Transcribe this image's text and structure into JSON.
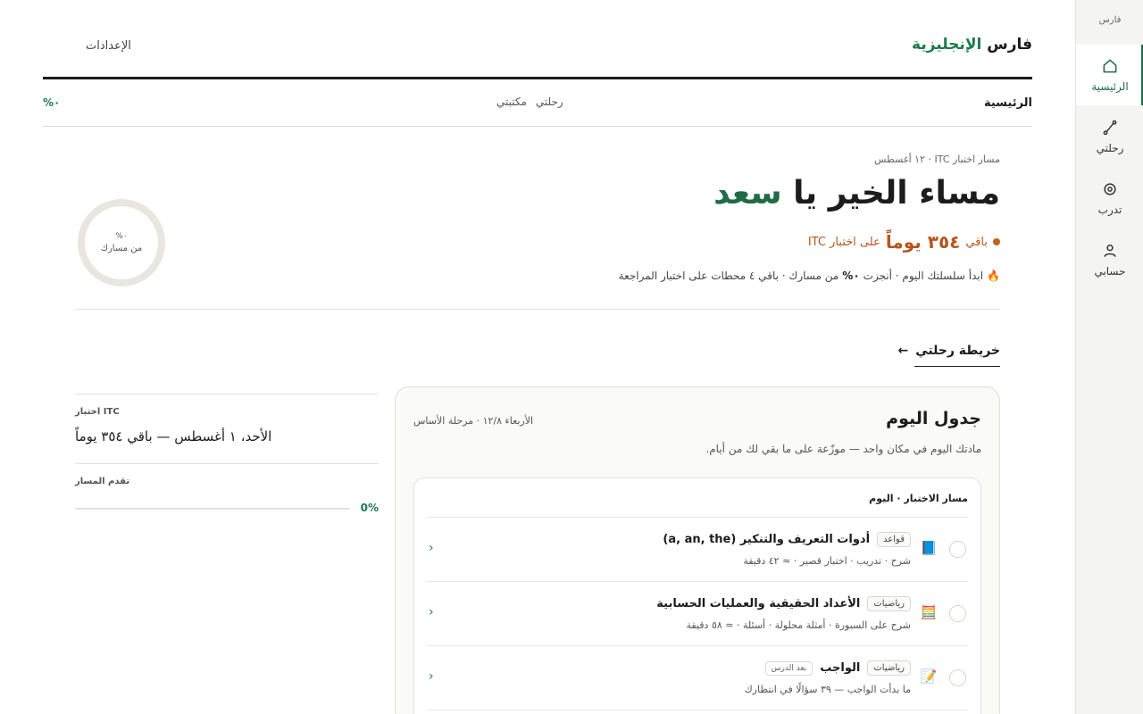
{
  "sidebar": {
    "brand": "فارس",
    "items": [
      {
        "label": "الرئيسية",
        "icon": "home-icon",
        "active": true
      },
      {
        "label": "رحلتي",
        "icon": "path-icon"
      },
      {
        "label": "تدرب",
        "icon": "target-icon"
      },
      {
        "label": "حسابي",
        "icon": "user-icon"
      }
    ]
  },
  "header": {
    "brand_main": "فارس",
    "brand_accent": "الإنجليزية",
    "settings": "الإعدادات"
  },
  "subnav": {
    "home": "الرئيسية",
    "journey": "رحلتي",
    "library": "مكتبتي",
    "percent": "٠%"
  },
  "hero": {
    "meta": "مسار اختبار ITC · ١٢ أغسطس",
    "greeting_prefix": "مساء الخير يا",
    "name": "سعد",
    "countdown_prefix": "باقي",
    "countdown_days": "٣٥٤ يوماً",
    "countdown_suffix": "على اختبار ITC",
    "streak_start": "ابدأ سلسلتك اليوم · أنجزت",
    "streak_pct": "٠%",
    "streak_end": "من مسارك · باقي ٤ محطات على اختبار المراجعة",
    "ring_value": "٠%",
    "ring_label": "من مسارك",
    "ring_progress": 0
  },
  "map_link": "خريطة رحلتي",
  "schedule": {
    "title": "جدول اليوم",
    "date": "الأربعاء ١٢/٨ · مرحلة الأساس",
    "description": "مادتك اليوم في مكان واحد — موزّعة على ما بقي لك من أيام.",
    "track_title": "مسار الاختبار · اليوم",
    "lessons": [
      {
        "tag": "قواعد",
        "name": "أدوات التعريف والتنكير (a, an, the)",
        "details": "شرح · تدريب · اختبار قصير · ≈ ٤٢ دقيقة",
        "icon": "book-icon",
        "extra": ""
      },
      {
        "tag": "رياضيات",
        "name": "الأعداد الحقيقية والعمليات الحسابية",
        "details": "شرح على السبورة · أمثلة محلولة · أسئلة · ≈ ٥٨ دقيقة",
        "icon": "abacus-icon",
        "extra": ""
      },
      {
        "tag": "رياضيات",
        "name": "الواجب",
        "details": "ما بدأت الواجب — ٣٩ سؤالًا في انتظارك",
        "icon": "memo-icon",
        "extra": "بعد الدرس"
      }
    ]
  },
  "exam": {
    "label": "ITC اختبار",
    "value": "الأحد، ١ أغسطس — باقي ٣٥٤ يوماً"
  },
  "progress": {
    "label": "تقدم المسار",
    "percent": "0%",
    "fraction": 0
  },
  "colors": {
    "accent": "#1f7a4c",
    "warning": "#c2621d"
  }
}
